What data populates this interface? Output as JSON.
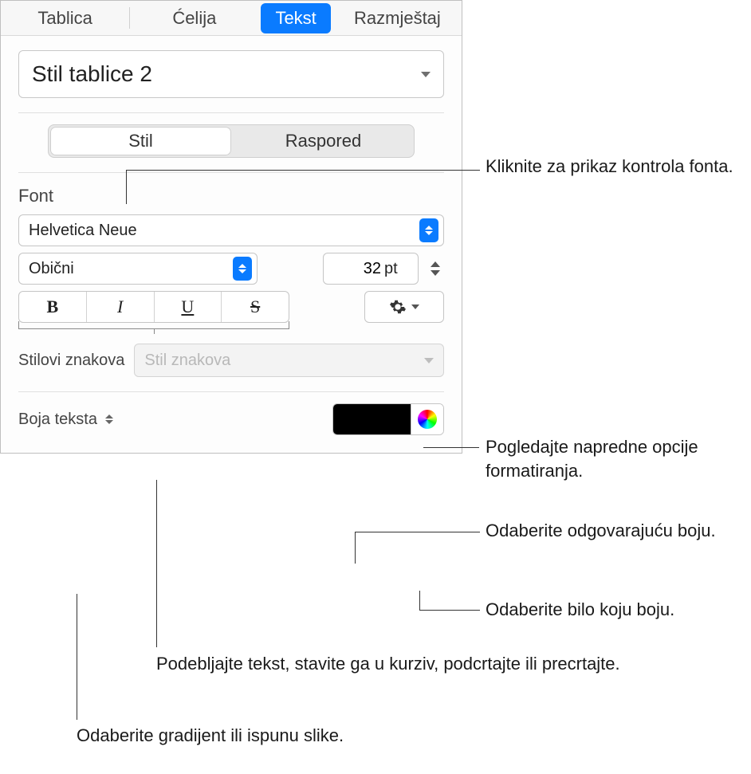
{
  "tabs": {
    "table": "Tablica",
    "cell": "Ćelija",
    "text": "Tekst",
    "arrange": "Razmještaj"
  },
  "style_name": "Stil tablice 2",
  "segment": {
    "style": "Stil",
    "layout": "Raspored"
  },
  "font": {
    "section_label": "Font",
    "family": "Helvetica Neue",
    "typeface": "Obični",
    "size": "32",
    "size_unit": "pt",
    "bold": "B",
    "italic": "I",
    "underline": "U",
    "strike": "S",
    "char_styles_label": "Stilovi znakova",
    "char_styles_placeholder": "Stil znakova",
    "text_color_label": "Boja teksta"
  },
  "callouts": {
    "font_controls": "Kliknite za prikaz kontrola fonta.",
    "advanced": "Pogledajte napredne opcije formatiranja.",
    "matching_color": "Odaberite odgovarajuću boju.",
    "any_color": "Odaberite bilo koju boju.",
    "bius": "Podebljajte tekst, stavite ga u kurziv, podcrtajte ili precrtajte.",
    "gradient": "Odaberite gradijent ili ispunu slike."
  }
}
